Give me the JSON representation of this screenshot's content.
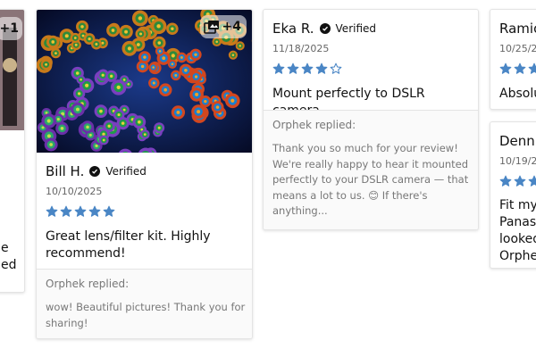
{
  "colors": {
    "star": "#4a86c5",
    "text": "#111111",
    "muted": "#777777",
    "border": "#e4e4e4"
  },
  "cards": {
    "left_partial": {
      "photo_count": "+1",
      "title_fragment_1": "e",
      "title_fragment_2": "ed"
    },
    "bill": {
      "photo_count": "+4",
      "name": "Bill H.",
      "verified": "Verified",
      "date": "10/10/2025",
      "rating": 5,
      "title": "Great lens/filter kit. Highly recommend!",
      "reply_label": "Orphek replied:",
      "reply_text": "wow! Beautiful pictures! Thank you for sharing!"
    },
    "eka": {
      "name": "Eka R.",
      "verified": "Verified",
      "date": "11/18/2025",
      "rating": 4,
      "title": "Mount perfectly to DSLR camera",
      "reply_label": "Orphek replied:",
      "reply_text": "Thank you so much for your review! We're really happy to hear it mounted perfectly to your DSLR camera — that means a lot to us. 😊 If there's anything..."
    },
    "ramio": {
      "name": "Ramio",
      "date": "10/25/20",
      "title": "Absolu"
    },
    "dennis": {
      "name": "Dennis",
      "date": "10/19/20",
      "title_line_1": "Fit my",
      "title_line_2": "Panaso",
      "title_line_3": "looked",
      "title_line_4": "Orphek"
    }
  }
}
